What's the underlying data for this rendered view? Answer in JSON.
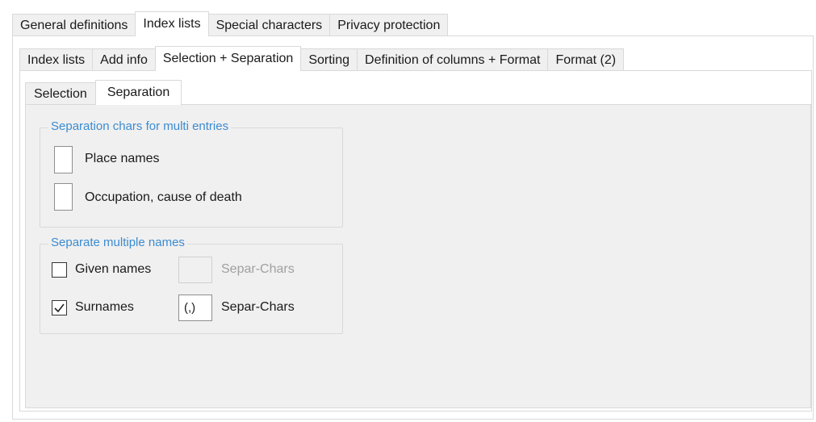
{
  "top_tabs": [
    "General definitions",
    "Index lists",
    "Special characters",
    "Privacy protection"
  ],
  "second_tabs": [
    "Index lists",
    "Add info",
    "Selection + Separation",
    "Sorting",
    "Definition of columns + Format",
    "Format (2)"
  ],
  "third_tabs": [
    "Selection",
    "Separation"
  ],
  "multi_entries": {
    "title": "Separation chars for multi entries",
    "place_label": "Place names",
    "place_value": "",
    "occupation_label": "Occupation, cause of death",
    "occupation_value": ""
  },
  "multiple_names": {
    "title": "Separate multiple names",
    "given_label": "Given names",
    "given_checked": false,
    "given_chars": "",
    "given_chars_label": "Separ-Chars",
    "surnames_label": "Surnames",
    "surnames_checked": true,
    "surnames_chars": "(,)",
    "surnames_chars_label": "Separ-Chars"
  },
  "colors": {
    "group_title": "#3b8bd1",
    "panel_bg": "#f0f0f0",
    "border": "#d9d9d9"
  }
}
